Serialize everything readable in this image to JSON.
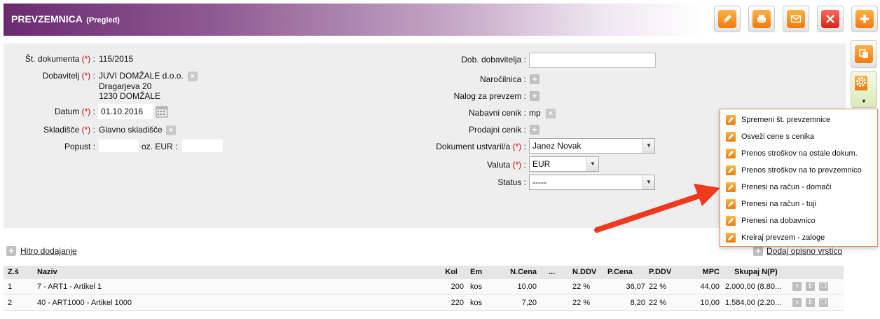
{
  "header": {
    "title": "PREVZEMNICA",
    "subtitle": "(Pregled)"
  },
  "toolbar": {
    "buttons": [
      "edit-icon",
      "print-icon",
      "mail-icon",
      "close-icon",
      "add-icon"
    ],
    "side_buttons": [
      "copy-icon",
      "gear-icon",
      "chevron-down-icon"
    ]
  },
  "form_left": {
    "doc_number_label": "Št. dokumenta",
    "doc_number_value": "115/2015",
    "supplier_label": "Dobavitelj",
    "supplier_line1": "JUVI DOMŽALE d.o.o.",
    "supplier_line2": "Dragarjeva 20",
    "supplier_line3": "1230 DOMŽALE",
    "date_label": "Datum",
    "date_value": "01.10.2016",
    "warehouse_label": "Skladišče",
    "warehouse_value": "Glavno skladišče",
    "discount_label": "Popust :",
    "discount_suffix": "oz. EUR :",
    "required_mark": "(*)",
    "colon": ":"
  },
  "form_right": {
    "supplier_doc_label": "Dob. dobavitelja :",
    "order_label": "Naročilnica :",
    "receipt_order_label": "Nalog za prevzem :",
    "purchase_price_label": "Nabavni cenik :",
    "purchase_price_value": "mp",
    "sales_price_label": "Prodajni cenik :",
    "created_by_label": "Dokument ustvaril/a",
    "created_by_value": "Janez Novak",
    "currency_label": "Valuta",
    "currency_value": "EUR",
    "status_label": "Status :",
    "status_value": "-----"
  },
  "links": {
    "quick_add": "Hitro dodajanje",
    "add_description_row": "Dodaj opisno vrstico"
  },
  "table": {
    "headers": [
      "Z.š",
      "Naziv",
      "Kol",
      "Em",
      "N.Cena",
      "...",
      "N.DDV",
      "P.Cena",
      "P.DDV",
      "MPC",
      "Skupaj N(P)"
    ],
    "rows": [
      [
        "1",
        "7 - ART1 - Artikel 1",
        "200",
        "kos",
        "10,00",
        "",
        "22 %",
        "36,07",
        "22 %",
        "44,00",
        "2.000,00 (8.80..."
      ],
      [
        "2",
        "40 - ART1000 - Artikel 1000",
        "220",
        "kos",
        "7,20",
        "",
        "22 %",
        "8,20",
        "22 %",
        "10,00",
        "1.584,00 (2.20..."
      ]
    ]
  },
  "dropdown_menu": {
    "items": [
      "Spremeni št. prevzemnice",
      "Osveži cene s cenika",
      "Prenos stroškov na ostale dokum.",
      "Prenos stroškov na to prevzemnico",
      "Prenesi na račun - domači",
      "Prenesi na račun - tuji",
      "Prenesi na dobavnico",
      "Kreiraj prevzem - zaloge"
    ]
  },
  "colors": {
    "accent": "#6b2a70",
    "arrow": "#f03a1e",
    "required": "#d40000"
  }
}
